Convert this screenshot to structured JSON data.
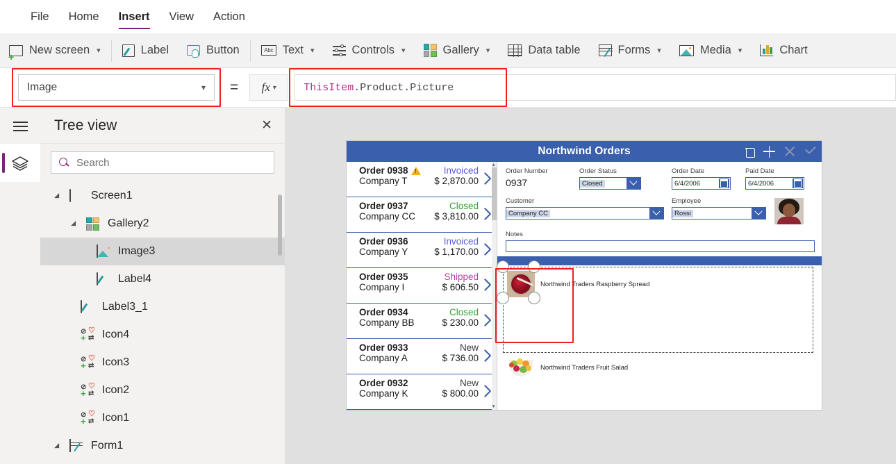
{
  "menu": {
    "items": [
      {
        "label": "File",
        "active": false
      },
      {
        "label": "Home",
        "active": false
      },
      {
        "label": "Insert",
        "active": true
      },
      {
        "label": "View",
        "active": false
      },
      {
        "label": "Action",
        "active": false
      }
    ]
  },
  "ribbon": {
    "items": [
      {
        "label": "New screen",
        "icon": "new-screen-icon",
        "caret": true
      },
      {
        "label": "Label",
        "icon": "label-icon",
        "caret": false
      },
      {
        "label": "Button",
        "icon": "button-icon",
        "caret": false
      },
      {
        "label": "Text",
        "icon": "abc-text-icon",
        "caret": true
      },
      {
        "label": "Controls",
        "icon": "controls-sliders-icon",
        "caret": true
      },
      {
        "label": "Gallery",
        "icon": "gallery-icon",
        "caret": true
      },
      {
        "label": "Data table",
        "icon": "data-table-icon",
        "caret": false
      },
      {
        "label": "Forms",
        "icon": "forms-icon",
        "caret": true
      },
      {
        "label": "Media",
        "icon": "media-image-icon",
        "caret": true
      },
      {
        "label": "Chart",
        "icon": "chart-bars-icon",
        "caret": false
      }
    ]
  },
  "formula_bar": {
    "property": "Image",
    "equals": "=",
    "fx": "fx",
    "formula_token": "ThisItem",
    "formula_rest": ".Product.Picture"
  },
  "tree_view": {
    "title": "Tree view",
    "close": "✕",
    "search_placeholder": "Search",
    "nodes": [
      {
        "label": "Screen1",
        "indent": 0,
        "icon": "screen-icon",
        "twisty": true,
        "selected": false
      },
      {
        "label": "Gallery2",
        "indent": 1,
        "icon": "gallery-icon",
        "twisty": true,
        "selected": false
      },
      {
        "label": "Image3",
        "indent": 2,
        "icon": "image-icon",
        "twisty": false,
        "selected": true
      },
      {
        "label": "Label4",
        "indent": 2,
        "icon": "label-icon",
        "twisty": false,
        "selected": false
      },
      {
        "label": "Label3_1",
        "indent": 1,
        "icon": "label-icon",
        "twisty": false,
        "selected": false
      },
      {
        "label": "Icon4",
        "indent": 1,
        "icon": "icon-group-icon",
        "twisty": false,
        "selected": false
      },
      {
        "label": "Icon3",
        "indent": 1,
        "icon": "icon-group-icon",
        "twisty": false,
        "selected": false
      },
      {
        "label": "Icon2",
        "indent": 1,
        "icon": "icon-group-icon",
        "twisty": false,
        "selected": false
      },
      {
        "label": "Icon1",
        "indent": 1,
        "icon": "icon-group-icon",
        "twisty": false,
        "selected": false
      },
      {
        "label": "Form1",
        "indent": 0,
        "icon": "form-icon",
        "twisty": true,
        "selected": false
      }
    ]
  },
  "app": {
    "title": "Northwind Orders",
    "actions": [
      {
        "name": "delete-icon",
        "glyph": "trash",
        "enabled": true
      },
      {
        "name": "add-icon",
        "glyph": "plus",
        "enabled": true
      },
      {
        "name": "cancel-icon",
        "glyph": "x",
        "enabled": false
      },
      {
        "name": "confirm-icon",
        "glyph": "check",
        "enabled": false
      }
    ],
    "gallery": [
      {
        "order": "Order 0938",
        "company": "Company T",
        "status": "Invoiced",
        "amount": "$ 2,870.00",
        "status_color": "#5b5bd6",
        "warning": true
      },
      {
        "order": "Order 0937",
        "company": "Company CC",
        "status": "Closed",
        "amount": "$ 3,810.00",
        "status_color": "#3aa23a",
        "warning": false
      },
      {
        "order": "Order 0936",
        "company": "Company Y",
        "status": "Invoiced",
        "amount": "$ 1,170.00",
        "status_color": "#5b5bd6",
        "warning": false
      },
      {
        "order": "Order 0935",
        "company": "Company I",
        "status": "Shipped",
        "amount": "$ 606.50",
        "status_color": "#c0399f",
        "warning": false
      },
      {
        "order": "Order 0934",
        "company": "Company BB",
        "status": "Closed",
        "amount": "$ 230.00",
        "status_color": "#3aa23a",
        "warning": false
      },
      {
        "order": "Order 0933",
        "company": "Company A",
        "status": "New",
        "amount": "$ 736.00",
        "status_color": "#3b3b3b",
        "warning": false
      },
      {
        "order": "Order 0932",
        "company": "Company K",
        "status": "New",
        "amount": "$ 800.00",
        "status_color": "#3b3b3b",
        "warning": false
      }
    ],
    "form": {
      "order_number_label": "Order Number",
      "order_number_value": "0937",
      "order_status_label": "Order Status",
      "order_status_value": "Closed",
      "order_date_label": "Order Date",
      "order_date_value": "6/4/2006",
      "paid_date_label": "Paid Date",
      "paid_date_value": "6/4/2006",
      "customer_label": "Customer",
      "customer_value": "Company CC",
      "employee_label": "Employee",
      "employee_value": "Rossi",
      "notes_label": "Notes",
      "notes_value": ""
    },
    "products": [
      {
        "name": "Northwind Traders Raspberry Spread",
        "thumb": "raspberry-spread-thumb",
        "selected": true
      },
      {
        "name": "Northwind Traders Fruit Salad",
        "thumb": "fruit-salad-thumb",
        "selected": false
      }
    ]
  },
  "colors": {
    "accent_purple": "#742774",
    "app_header_blue": "#3a5fad",
    "annotation_red": "#ee2020",
    "canvas_bg": "#e0e0e0"
  }
}
